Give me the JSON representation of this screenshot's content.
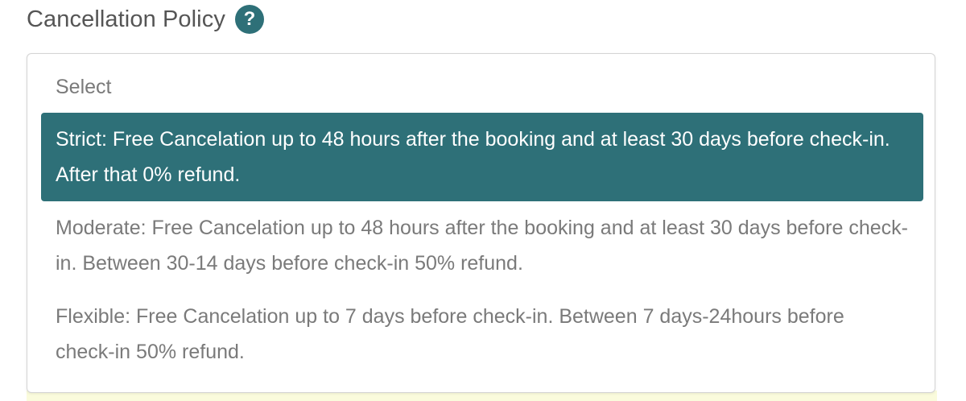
{
  "field": {
    "label": "Cancellation Policy",
    "help_icon": "?"
  },
  "select": {
    "placeholder": "Select",
    "selected_index": 0,
    "options": [
      {
        "label": "Strict: Free Cancelation up to 48 hours after the booking and at least 30 days before check-in. After that 0% refund."
      },
      {
        "label": "Moderate: Free Cancelation up to 48 hours after the booking and at least 30 days before check-in. Between 30-14 days before check-in 50% refund."
      },
      {
        "label": "Flexible: Free Cancelation up to 7 days before check-in. Between 7 days-24hours before check-in 50% refund."
      }
    ]
  },
  "colors": {
    "accent": "#2e7078",
    "label_text": "#555555",
    "option_text": "#7a7a7a"
  }
}
